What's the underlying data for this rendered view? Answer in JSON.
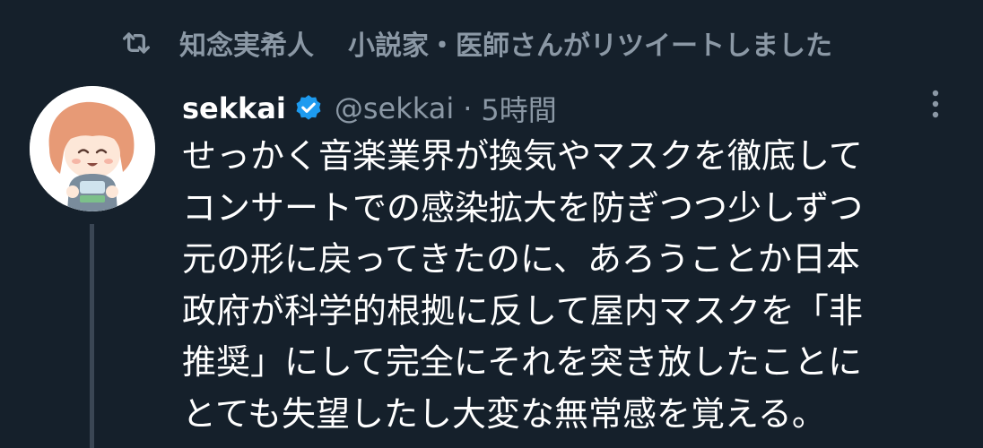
{
  "retweet": {
    "icon": "retweet-icon",
    "retweeter": "知念実希人",
    "suffix": "小説家・医師さんがリツイートしました"
  },
  "author": {
    "display_name": "sekkai",
    "verified_icon": "verified-badge-icon",
    "handle": "@sekkai",
    "separator": "·",
    "time": "5時間"
  },
  "more_icon": "more-vertical-icon",
  "tweet": {
    "lines": [
      "せっかく音楽業界が換気やマスクを徹底して",
      "コンサートでの感染拡大を防ぎつつ少しずつ",
      "元の形に戻ってきたのに、あろうことか日本",
      "政府が科学的根拠に反して屋内マスクを「非",
      "推奨」にして完全にそれを突き放したことに",
      "とても失望したし大変な無常感を覚える。"
    ]
  },
  "colors": {
    "background": "#15202b",
    "muted": "#8b98a5",
    "verified": "#1d9bf0",
    "thread_line": "#3a4654"
  }
}
